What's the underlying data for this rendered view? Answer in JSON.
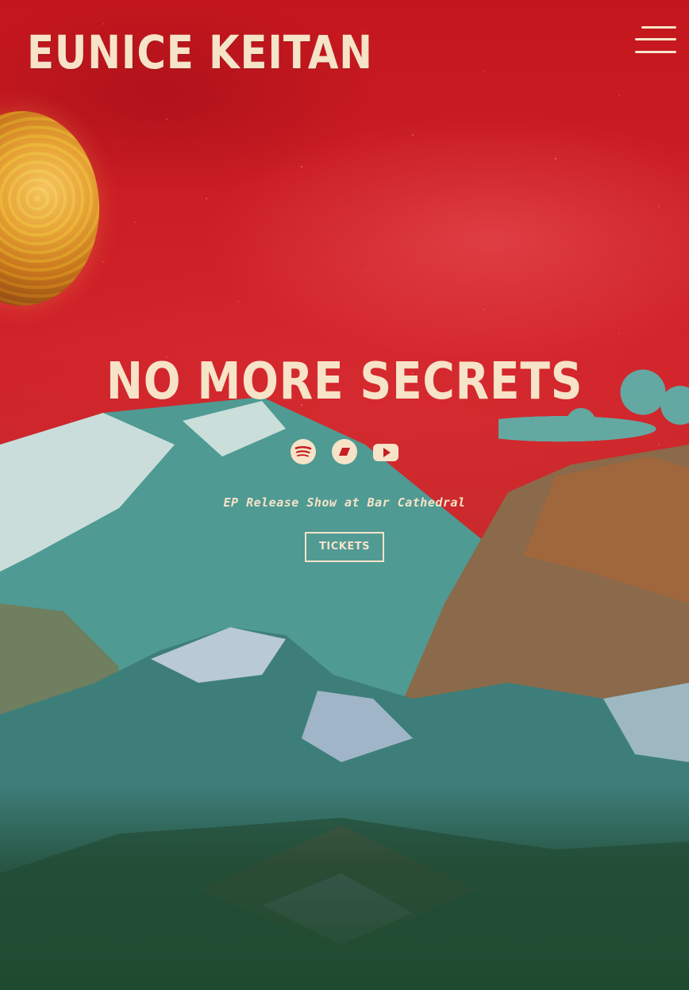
{
  "header": {
    "site_title": "EUNICE KEITAN",
    "menu_icon": "hamburger-menu-icon"
  },
  "hero": {
    "title": "NO MORE SECRETS",
    "streaming_links": [
      {
        "name": "Spotify",
        "icon": "spotify-icon"
      },
      {
        "name": "Bandcamp",
        "icon": "bandcamp-icon"
      },
      {
        "name": "YouTube",
        "icon": "youtube-icon"
      }
    ],
    "event_text": "EP Release Show at Bar Cathedral",
    "tickets_label": "TICKETS"
  },
  "colors": {
    "text_cream": "#f6e3c8",
    "sky_red": "#c41f24",
    "mountain_teal": "#4f9a93"
  }
}
